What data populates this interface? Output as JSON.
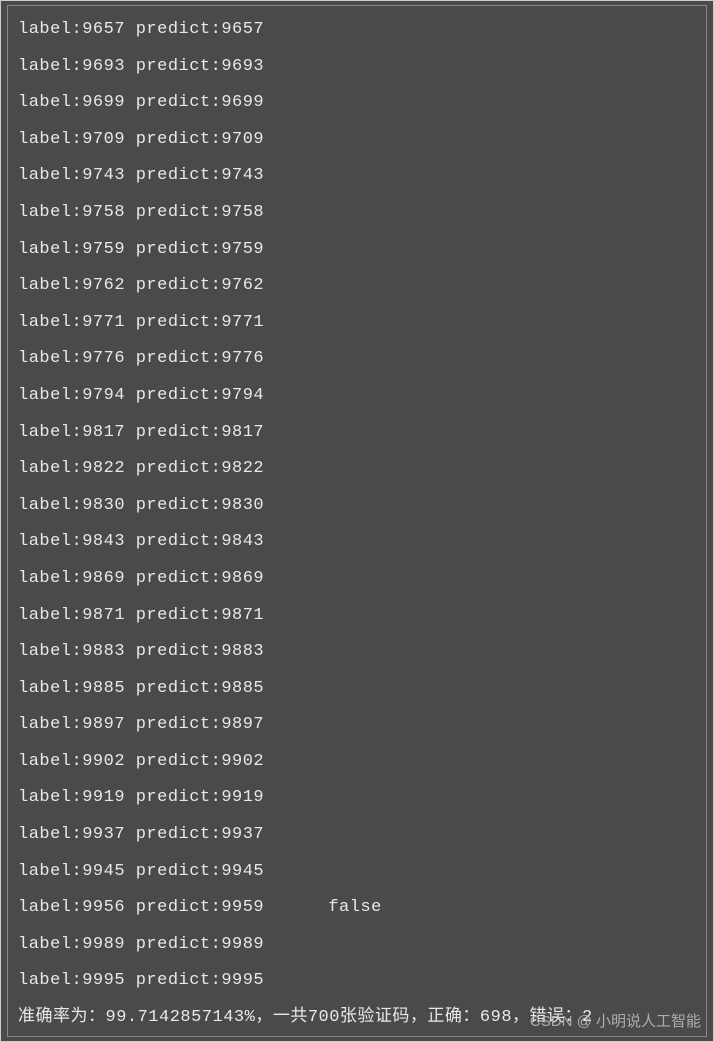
{
  "output": {
    "rows": [
      {
        "label": "9657",
        "predict": "9657",
        "flag": ""
      },
      {
        "label": "9693",
        "predict": "9693",
        "flag": ""
      },
      {
        "label": "9699",
        "predict": "9699",
        "flag": ""
      },
      {
        "label": "9709",
        "predict": "9709",
        "flag": ""
      },
      {
        "label": "9743",
        "predict": "9743",
        "flag": ""
      },
      {
        "label": "9758",
        "predict": "9758",
        "flag": ""
      },
      {
        "label": "9759",
        "predict": "9759",
        "flag": ""
      },
      {
        "label": "9762",
        "predict": "9762",
        "flag": ""
      },
      {
        "label": "9771",
        "predict": "9771",
        "flag": ""
      },
      {
        "label": "9776",
        "predict": "9776",
        "flag": ""
      },
      {
        "label": "9794",
        "predict": "9794",
        "flag": ""
      },
      {
        "label": "9817",
        "predict": "9817",
        "flag": ""
      },
      {
        "label": "9822",
        "predict": "9822",
        "flag": ""
      },
      {
        "label": "9830",
        "predict": "9830",
        "flag": ""
      },
      {
        "label": "9843",
        "predict": "9843",
        "flag": ""
      },
      {
        "label": "9869",
        "predict": "9869",
        "flag": ""
      },
      {
        "label": "9871",
        "predict": "9871",
        "flag": ""
      },
      {
        "label": "9883",
        "predict": "9883",
        "flag": ""
      },
      {
        "label": "9885",
        "predict": "9885",
        "flag": ""
      },
      {
        "label": "9897",
        "predict": "9897",
        "flag": ""
      },
      {
        "label": "9902",
        "predict": "9902",
        "flag": ""
      },
      {
        "label": "9919",
        "predict": "9919",
        "flag": ""
      },
      {
        "label": "9937",
        "predict": "9937",
        "flag": ""
      },
      {
        "label": "9945",
        "predict": "9945",
        "flag": ""
      },
      {
        "label": "9956",
        "predict": "9959",
        "flag": "false"
      },
      {
        "label": "9989",
        "predict": "9989",
        "flag": ""
      },
      {
        "label": "9995",
        "predict": "9995",
        "flag": ""
      }
    ],
    "labelPrefix": "label:",
    "predictPrefix": "predict:",
    "summary": "准确率为：99.7142857143%，一共700张验证码，正确：698，错误：2"
  },
  "watermark": "CSDN @ 小明说人工智能"
}
